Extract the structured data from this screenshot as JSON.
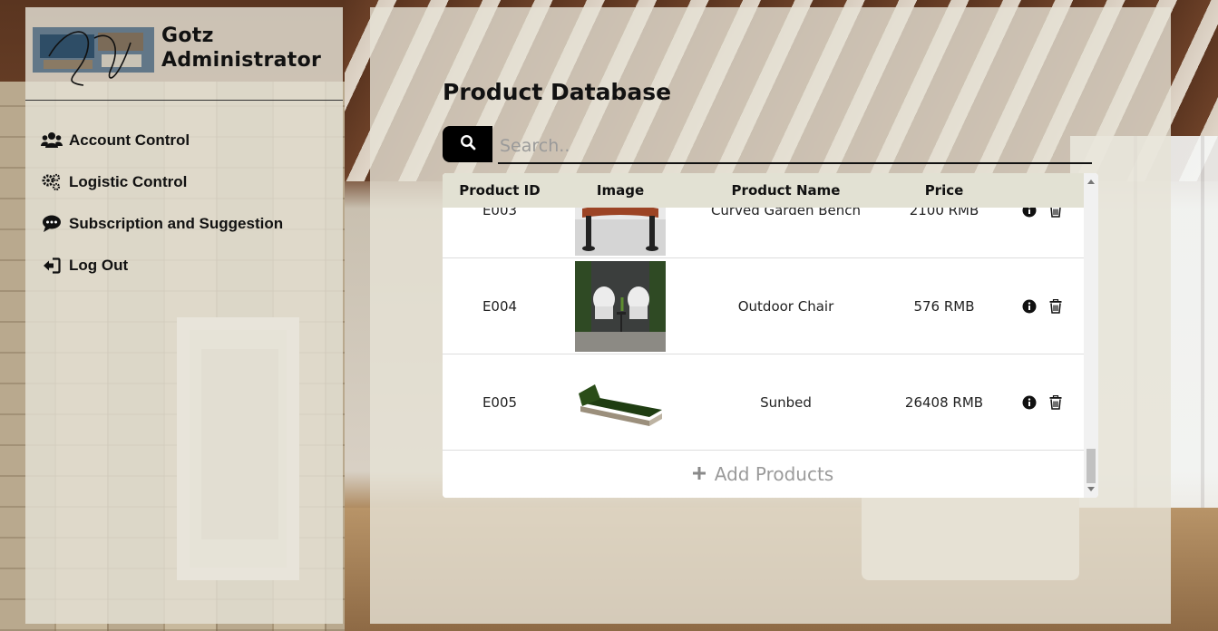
{
  "brand": {
    "line1": "Gotz",
    "line2": "Administrator"
  },
  "sidebar": {
    "items": [
      {
        "label": "Account Control",
        "icon": "users-icon"
      },
      {
        "label": "Logistic Control",
        "icon": "gears-icon"
      },
      {
        "label": "Subscription and Suggestion",
        "icon": "comment-dots-icon"
      },
      {
        "label": "Log Out",
        "icon": "sign-out-icon"
      }
    ]
  },
  "main": {
    "title": "Product Database",
    "search": {
      "placeholder": "Search..",
      "value": ""
    }
  },
  "table": {
    "columns": [
      "Product ID",
      "Image",
      "Product Name",
      "Price"
    ],
    "rows": [
      {
        "id": "E003",
        "name": "Curved Garden Bench",
        "price": "2100 RMB",
        "image": "garden-bench-image"
      },
      {
        "id": "E004",
        "name": "Outdoor Chair",
        "price": "576 RMB",
        "image": "outdoor-chair-image"
      },
      {
        "id": "E005",
        "name": "Sunbed",
        "price": "26408 RMB",
        "image": "sunbed-image"
      }
    ],
    "add_label": "Add Products"
  },
  "colors": {
    "panel": "#e4e0d4",
    "table_header": "#e2e1d3",
    "search_button": "#000000"
  }
}
